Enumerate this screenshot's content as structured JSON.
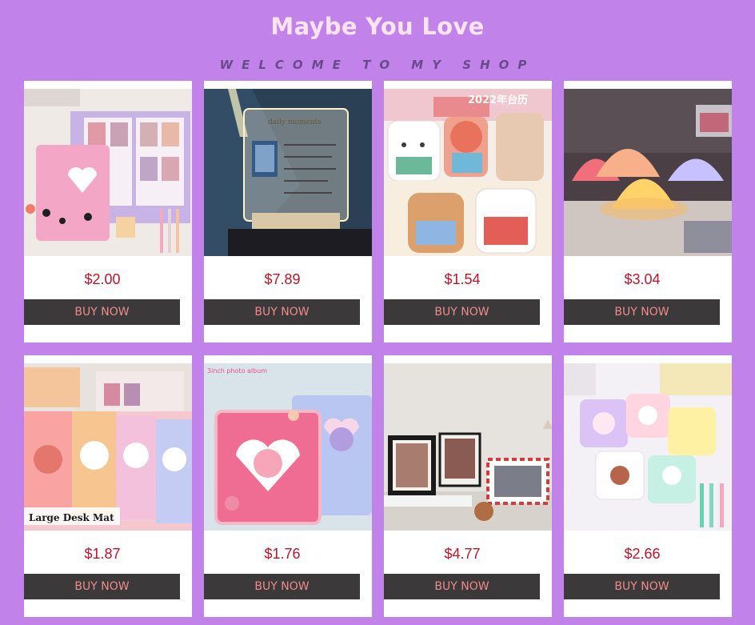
{
  "header": {
    "title": "Maybe You Love",
    "subtitle": "WELCOME TO MY SHOP"
  },
  "products": [
    {
      "price": "$2.00",
      "button": "BUY NOW",
      "image_text": ""
    },
    {
      "price": "$7.89",
      "button": "BUY NOW",
      "image_text": "daily moments"
    },
    {
      "price": "$1.54",
      "button": "BUY NOW",
      "image_text": "2022年台历"
    },
    {
      "price": "$3.04",
      "button": "BUY NOW",
      "image_text": ""
    },
    {
      "price": "$1.87",
      "button": "BUY NOW",
      "image_text": "Large Desk Mat"
    },
    {
      "price": "$1.76",
      "button": "BUY NOW",
      "image_text": "3inch photo album"
    },
    {
      "price": "$4.77",
      "button": "BUY NOW",
      "image_text": ""
    },
    {
      "price": "$2.66",
      "button": "BUY NOW",
      "image_text": ""
    }
  ],
  "colors": {
    "background": "#c183ea",
    "price": "#c0132a",
    "button_bg": "#3b393a",
    "button_text": "#f18a8a"
  }
}
